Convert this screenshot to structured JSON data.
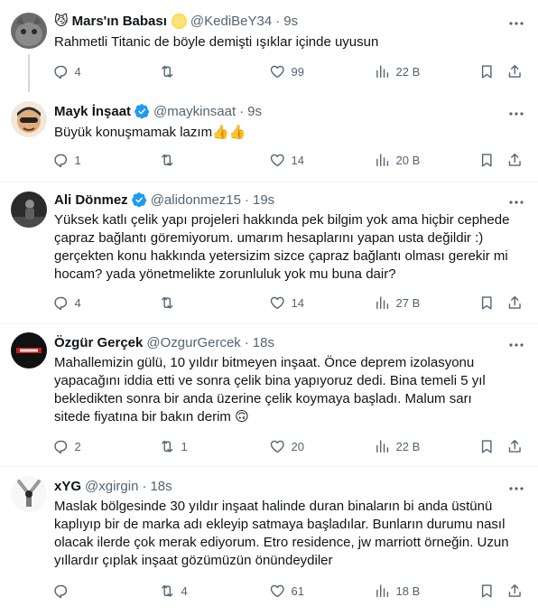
{
  "tweets": [
    {
      "name": "Mars'ın Babası",
      "handle": "@KediBeY34",
      "time": "9s",
      "text": "Rahmetli Titanic de böyle demişti  ışıklar içinde uyusun",
      "replies": "4",
      "retweets": "",
      "likes": "99",
      "views": "22 B"
    },
    {
      "name": "Mayk İnşaat",
      "handle": "@maykinsaat",
      "time": "9s",
      "text": "Büyük konuşmamak lazım👍👍",
      "replies": "1",
      "retweets": "",
      "likes": "14",
      "views": "20 B"
    },
    {
      "name": "Ali Dönmez",
      "handle": "@alidonmez15",
      "time": "19s",
      "text_lines": [
        "Yüksek katlı çelik yapı projeleri hakkında pek bilgim yok ama hiçbir cephede",
        "çapraz bağlantı göremiyorum. umarım hesaplarını yapan usta değildir :)",
        "gerçekten konu hakkında yetersizim sizce çapraz bağlantı olması gerekir mi",
        "hocam? yada yönetmelikte zorunluluk yok mu buna dair?"
      ],
      "replies": "4",
      "retweets": "",
      "likes": "14",
      "views": "27 B"
    },
    {
      "name": "Özgür Gerçek",
      "handle": "@OzgurGercek",
      "time": "18s",
      "text_lines": [
        "Mahallemizin gülü, 10 yıldır bitmeyen inşaat. Önce deprem izolasyonu",
        "yapacağını iddia etti ve sonra çelik bina yapıyoruz dedi. Bina temeli 5 yıl",
        "bekledikten sonra bir anda üzerine çelik koymaya başladı. Malum sarı",
        "sitede fiyatına bir bakın derim 🙃"
      ],
      "replies": "2",
      "retweets": "1",
      "likes": "20",
      "views": "22 B"
    },
    {
      "name": "xYG",
      "handle": "@xgirgin",
      "time": "18s",
      "text_lines": [
        "Maslak bölgesinde 30 yıldır inşaat halinde duran binaların bi anda üstünü",
        "kaplıyıp bir de marka adı ekleyip satmaya başladılar. Bunların durumu nasıl",
        "olacak ilerde çok merak ediyorum. Etro residence, jw marriott örneğin. Uzun",
        "yıllardır çıplak inşaat gözümüzün önündeydiler"
      ],
      "replies": "",
      "retweets": "4",
      "likes": "61",
      "views": "18 B"
    }
  ],
  "colors": {
    "text": "#0f1419",
    "secondary": "#536471",
    "divider": "#eff3f4",
    "verified": "#1d9bf0"
  }
}
